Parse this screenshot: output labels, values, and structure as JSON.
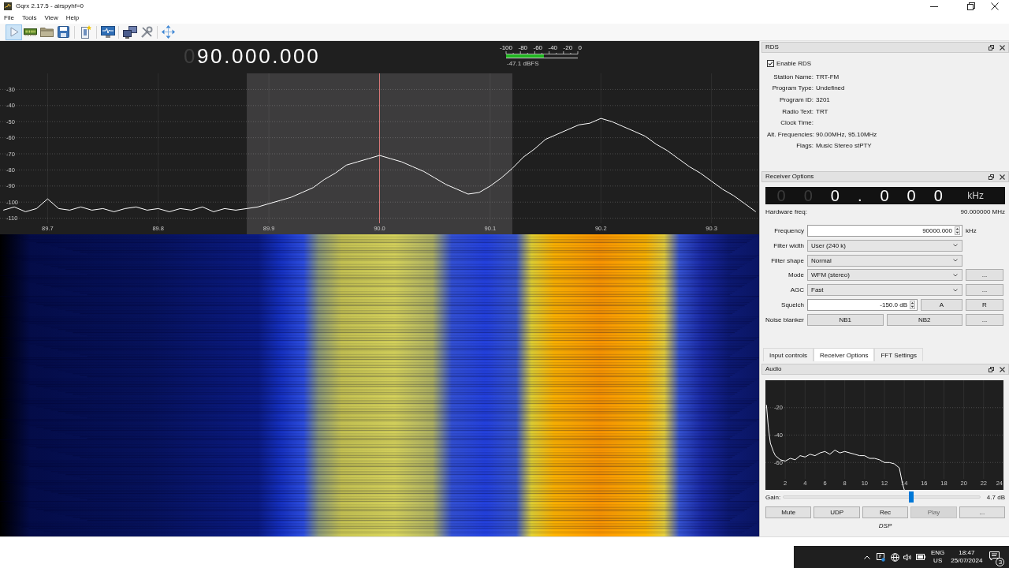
{
  "window": {
    "title": "Gqrx 2.17.5 - airspyhf=0"
  },
  "menu": [
    "File",
    "Tools",
    "View",
    "Help"
  ],
  "toolbar": {
    "play_pressed": true
  },
  "plotter": {
    "frequency": [
      {
        "text": "0",
        "dim": true
      },
      {
        "text": "90.000.000",
        "dim": false
      }
    ],
    "meter": {
      "scale": [
        "-100",
        "-80",
        "-60",
        "-40",
        "-20",
        "0"
      ],
      "level": 0.53,
      "reading": "-47.1 dBFS"
    },
    "chart_data": [
      {
        "type": "line",
        "x": [
          89.66,
          89.67,
          89.68,
          89.69,
          89.7,
          89.71,
          89.72,
          89.73,
          89.74,
          89.75,
          89.76,
          89.77,
          89.78,
          89.79,
          89.8,
          89.81,
          89.82,
          89.83,
          89.84,
          89.85,
          89.86,
          89.87,
          89.88,
          89.89,
          89.9,
          89.91,
          89.92,
          89.93,
          89.94,
          89.95,
          89.96,
          89.97,
          89.98,
          89.99,
          90,
          90.01,
          90.02,
          90.03,
          90.04,
          90.05,
          90.06,
          90.07,
          90.08,
          90.09,
          90.1,
          90.11,
          90.12,
          90.13,
          90.14,
          90.15,
          90.16,
          90.17,
          90.18,
          90.19,
          90.2,
          90.21,
          90.22,
          90.23,
          90.24,
          90.25,
          90.26,
          90.27,
          90.28,
          90.29,
          90.3,
          90.31,
          90.32,
          90.33,
          90.34
        ],
        "values": [
          -105,
          -103,
          -106,
          -104,
          -98,
          -104,
          -105,
          -103,
          -105,
          -104,
          -106,
          -104,
          -103,
          -105,
          -104,
          -106,
          -104,
          -105,
          -103,
          -106,
          -104,
          -105,
          -104,
          -103,
          -101,
          -99,
          -97,
          -94,
          -91,
          -86,
          -82,
          -77,
          -75,
          -73,
          -71,
          -73,
          -75,
          -78,
          -81,
          -85,
          -89,
          -92,
          -95,
          -94,
          -90,
          -85,
          -79,
          -72,
          -67,
          -61,
          -58,
          -55,
          -52,
          -51,
          -48,
          -50,
          -53,
          -56,
          -59,
          -64,
          -68,
          -73,
          -78,
          -82,
          -87,
          -92,
          -96,
          -101,
          -106
        ],
        "color": "#ffffff",
        "xlim": [
          89.657,
          90.343
        ],
        "ylim": [
          -120,
          -20
        ],
        "xticks": [
          89.7,
          89.8,
          89.9,
          {
            "value": 90,
            "label": "90.0"
          },
          90.1,
          90.2,
          90.3
        ],
        "yticks": [
          -30,
          -40,
          -50,
          -60,
          -70,
          -80,
          -90,
          -100,
          -110
        ],
        "grid": true,
        "bands": [
          {
            "axis": "x",
            "from": 89.88,
            "to": 90.12,
            "color": "#3d3c3d"
          }
        ],
        "ref_lines": [
          {
            "axis": "x",
            "value": 90,
            "color": "#d87878"
          }
        ]
      }
    ]
  },
  "rds": {
    "title": "RDS",
    "enabled": true,
    "enable_label": "Enable RDS",
    "fields": [
      {
        "label": "Station Name:",
        "value": "TRT-FM"
      },
      {
        "label": "Program Type:",
        "value": "Undefined"
      },
      {
        "label": "Program ID:",
        "value": "3201"
      },
      {
        "label": "Radio Text:",
        "value": "TRT"
      },
      {
        "label": "Clock Time:"
      },
      {
        "label": "Alt. Frequencies:",
        "value": "90.00MHz, 95.10MHz"
      },
      {
        "label": "Flags:",
        "value": "Music Stereo stPTY"
      }
    ]
  },
  "receiver_options": {
    "title": "Receiver Options",
    "digits": [
      {
        "text": "0",
        "dim": true
      },
      {
        "text": "0",
        "dim": true
      },
      {
        "text": "0",
        "dim": false
      },
      {
        "text": ".",
        "dim": false
      },
      {
        "text": "0",
        "dim": false
      },
      {
        "text": "0",
        "dim": false
      },
      {
        "text": "0",
        "dim": false
      }
    ],
    "unit": "kHz",
    "hardware_label": "Hardware freq:",
    "hardware_value": "90.000000 MHz",
    "rows": [
      {
        "label": "Frequency",
        "kind": "spinbox",
        "value": "90000.000",
        "unit": "kHz"
      },
      {
        "label": "Filter width",
        "kind": "combo",
        "value": "User (240 k)"
      },
      {
        "label": "Filter shape",
        "kind": "combo",
        "value": "Normal"
      },
      {
        "label": "Mode",
        "kind": "combo",
        "value": "WFM (stereo)",
        "buttons": [
          "..."
        ]
      },
      {
        "label": "AGC",
        "kind": "combo",
        "value": "Fast",
        "buttons": [
          "..."
        ]
      },
      {
        "label": "Squelch",
        "kind": "spinbox",
        "value": "-150.0 dB",
        "buttons": [
          "A",
          "R"
        ]
      },
      {
        "label": "Noise blanker",
        "kind": "buttons",
        "buttons": [
          "NB1",
          "NB2",
          "..."
        ]
      }
    ]
  },
  "tabs": [
    {
      "label": "Input controls",
      "selected": false
    },
    {
      "label": "Receiver Options",
      "selected": true
    },
    {
      "label": "FFT Settings",
      "selected": false
    }
  ],
  "audio": {
    "title": "Audio",
    "chart_data": [
      {
        "type": "line",
        "x": [
          0.1,
          0.3,
          0.5,
          0.8,
          1,
          1.5,
          2,
          2.5,
          3,
          3.5,
          4,
          4.5,
          5,
          5.5,
          6,
          6.5,
          7,
          7.5,
          8,
          8.5,
          9,
          9.5,
          10,
          10.5,
          11,
          11.5,
          12,
          12.5,
          13,
          13.5,
          13.8,
          14
        ],
        "values": [
          -18,
          -35,
          -46,
          -52,
          -55,
          -58,
          -59,
          -57,
          -58,
          -55,
          -56,
          -54,
          -55,
          -53,
          -52,
          -54,
          -51,
          -53,
          -52,
          -53,
          -54,
          -55,
          -55,
          -57,
          -57,
          -58,
          -60,
          -60,
          -61,
          -64,
          -75,
          -80
        ],
        "color": "#ffffff",
        "xlim": [
          0,
          24
        ],
        "ylim": [
          -80,
          0
        ],
        "xticks": [
          2,
          4,
          6,
          8,
          10,
          12,
          14,
          16,
          18,
          20,
          22,
          24
        ],
        "yticks": [
          -20,
          -40,
          -60
        ],
        "grid": true
      }
    ],
    "gain_label": "Gain:",
    "gain": {
      "level": 0.65,
      "reading": "4.7 dB"
    },
    "buttons": [
      {
        "label": "Mute",
        "disabled": false
      },
      {
        "label": "UDP",
        "disabled": false
      },
      {
        "label": "Rec",
        "disabled": false
      },
      {
        "label": "Play",
        "disabled": true
      },
      {
        "label": "...",
        "disabled": false
      }
    ],
    "footer": "DSP"
  },
  "taskbar": {
    "language": "ENG",
    "region": "US",
    "time": "18:47",
    "date": "25/07/2024",
    "notifications": "3"
  }
}
